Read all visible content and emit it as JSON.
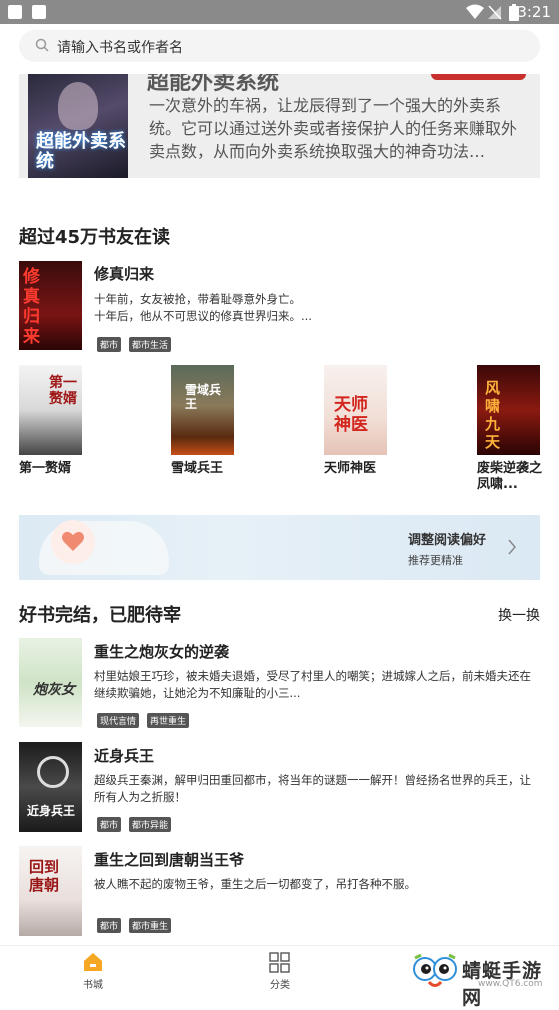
{
  "status_bar": {
    "time": "3:21"
  },
  "search": {
    "placeholder": "请输入书名或作者名"
  },
  "banner": {
    "cover_title": "超能外卖系统",
    "description": "一次意外的车祸，让龙辰得到了一个强大的外卖系统。它可以通过送外卖或者接保护人的任务来赚取外卖点数，从而向外卖系统换取强大的神奇功法…",
    "colors": {
      "tag": "#c8302e"
    }
  },
  "section_reading": {
    "title": "超过45万书友在读",
    "featured": {
      "cover_title": "修真归来",
      "title": "修真归来",
      "desc_line1": "十年前，女友被抢，带着耻辱意外身亡。",
      "desc_line2": "十年后，他从不可思议的修真世界归来。...",
      "tags": [
        "都市",
        "都市生活"
      ]
    },
    "grid": [
      {
        "title": "第一赘婿",
        "cover_title": "第一赘婿"
      },
      {
        "title": "雪域兵王",
        "cover_title": "雪域兵王"
      },
      {
        "title": "天师神医",
        "cover_title": "天师神医"
      },
      {
        "title": "废柴逆袭之凤啸...",
        "cover_title": "风啸九天"
      }
    ]
  },
  "preference": {
    "title": "调整阅读偏好",
    "subtitle": "推荐更精准"
  },
  "section_finished": {
    "title": "好书完结，已肥待宰",
    "refresh_label": "换一换",
    "books": [
      {
        "title": "重生之炮灰女的逆袭",
        "cover_title": "炮灰女",
        "desc": "村里姑娘王巧珍，被未婚夫退婚，受尽了村里人的嘲笑；进城嫁人之后，前未婚夫还在继续欺骗她，让她沦为不知廉耻的小三...",
        "tags": [
          "现代言情",
          "再世重生"
        ]
      },
      {
        "title": "近身兵王",
        "cover_title": "近身兵王",
        "desc": "超级兵王秦渊，解甲归田重回都市，将当年的谜题一一解开！曾经扬名世界的兵王，让所有人为之折服！",
        "tags": [
          "都市",
          "都市异能"
        ]
      },
      {
        "title": "重生之回到唐朝当王爷",
        "cover_title": "回到唐朝",
        "desc": "被人瞧不起的废物王爷，重生之后一切都变了，吊打各种不服。",
        "tags": [
          "都市",
          "都市重生"
        ]
      }
    ]
  },
  "tabbar": {
    "items": [
      {
        "label": "书城",
        "icon": "home-icon",
        "active": true
      },
      {
        "label": "分类",
        "icon": "grid-icon",
        "active": false
      }
    ],
    "accent": "#f5a623"
  },
  "watermark": {
    "text": "蜻蜓手游网",
    "url_text": "www.QT6.com"
  }
}
